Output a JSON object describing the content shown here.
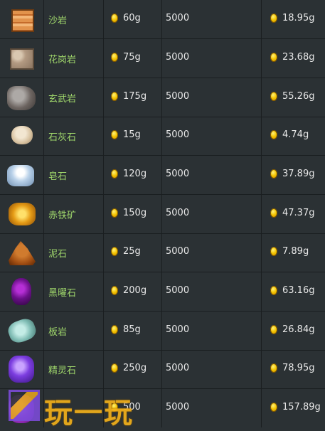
{
  "rows": [
    {
      "name": "沙岩",
      "price": "60g",
      "qty": "5000",
      "total": "18.95g",
      "icon": "sandstone-icon"
    },
    {
      "name": "花岗岩",
      "price": "75g",
      "qty": "5000",
      "total": "23.68g",
      "icon": "granite-icon"
    },
    {
      "name": "玄武岩",
      "price": "175g",
      "qty": "5000",
      "total": "55.26g",
      "icon": "basalt-icon"
    },
    {
      "name": "石灰石",
      "price": "15g",
      "qty": "5000",
      "total": "4.74g",
      "icon": "limestone-icon"
    },
    {
      "name": "皂石",
      "price": "120g",
      "qty": "5000",
      "total": "37.89g",
      "icon": "soapstone-icon"
    },
    {
      "name": "赤铁矿",
      "price": "150g",
      "qty": "5000",
      "total": "47.37g",
      "icon": "hematite-icon"
    },
    {
      "name": "泥石",
      "price": "25g",
      "qty": "5000",
      "total": "7.89g",
      "icon": "mudstone-icon"
    },
    {
      "name": "黑曜石",
      "price": "200g",
      "qty": "5000",
      "total": "63.16g",
      "icon": "obsidian-icon"
    },
    {
      "name": "板岩",
      "price": "85g",
      "qty": "5000",
      "total": "26.84g",
      "icon": "slate-icon"
    },
    {
      "name": "精灵石",
      "price": "250g",
      "qty": "5000",
      "total": "78.95g",
      "icon": "fairy-stone-icon"
    },
    {
      "name": "",
      "price": "500",
      "qty": "5000",
      "total": "157.89g",
      "icon": "star-shards-icon"
    }
  ],
  "watermark": {
    "text": "玩一玩"
  },
  "colors": {
    "background": "#2b3134",
    "name_text": "#9fd66b",
    "value_text": "#e8e8e8",
    "coin": "#f5c400"
  }
}
